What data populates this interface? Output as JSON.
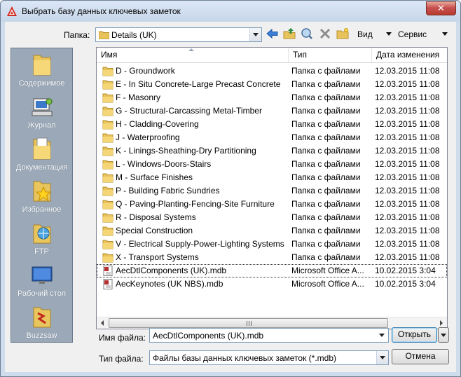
{
  "window": {
    "title": "Выбрать базу данных ключевых заметок",
    "close_label": "✕"
  },
  "toolbar": {
    "folder_label": "Папка:",
    "folder_value": "Details (UK)",
    "view_label": "Вид",
    "service_label": "Сервис"
  },
  "places": [
    {
      "label": "Содержимое",
      "icon": "folder-icon"
    },
    {
      "label": "Журнал",
      "icon": "history-icon"
    },
    {
      "label": "Документация",
      "icon": "documents-icon"
    },
    {
      "label": "Избранное",
      "icon": "favorites-icon"
    },
    {
      "label": "FTP",
      "icon": "ftp-icon"
    },
    {
      "label": "Рабочий стол",
      "icon": "desktop-icon"
    },
    {
      "label": "Buzzsaw",
      "icon": "buzzsaw-icon"
    }
  ],
  "filelist": {
    "columns": [
      "Имя",
      "Тип",
      "Дата изменения"
    ],
    "rows": [
      {
        "name": "D - Groundwork",
        "type": "Папка с файлами",
        "date": "12.03.2015 11:08",
        "kind": "folder"
      },
      {
        "name": "E - In Situ Concrete-Large Precast Concrete",
        "type": "Папка с файлами",
        "date": "12.03.2015 11:08",
        "kind": "folder"
      },
      {
        "name": "F - Masonry",
        "type": "Папка с файлами",
        "date": "12.03.2015 11:08",
        "kind": "folder"
      },
      {
        "name": "G - Structural-Carcassing Metal-Timber",
        "type": "Папка с файлами",
        "date": "12.03.2015 11:08",
        "kind": "folder"
      },
      {
        "name": "H - Cladding-Covering",
        "type": "Папка с файлами",
        "date": "12.03.2015 11:08",
        "kind": "folder"
      },
      {
        "name": "J - Waterproofing",
        "type": "Папка с файлами",
        "date": "12.03.2015 11:08",
        "kind": "folder"
      },
      {
        "name": "K - Linings-Sheathing-Dry Partitioning",
        "type": "Папка с файлами",
        "date": "12.03.2015 11:08",
        "kind": "folder"
      },
      {
        "name": "L - Windows-Doors-Stairs",
        "type": "Папка с файлами",
        "date": "12.03.2015 11:08",
        "kind": "folder"
      },
      {
        "name": "M - Surface Finishes",
        "type": "Папка с файлами",
        "date": "12.03.2015 11:08",
        "kind": "folder"
      },
      {
        "name": "P - Building Fabric Sundries",
        "type": "Папка с файлами",
        "date": "12.03.2015 11:08",
        "kind": "folder"
      },
      {
        "name": "Q - Paving-Planting-Fencing-Site Furniture",
        "type": "Папка с файлами",
        "date": "12.03.2015 11:08",
        "kind": "folder"
      },
      {
        "name": "R - Disposal Systems",
        "type": "Папка с файлами",
        "date": "12.03.2015 11:08",
        "kind": "folder"
      },
      {
        "name": "Special Construction",
        "type": "Папка с файлами",
        "date": "12.03.2015 11:08",
        "kind": "folder"
      },
      {
        "name": "V - Electrical Supply-Power-Lighting Systems",
        "type": "Папка с файлами",
        "date": "12.03.2015 11:08",
        "kind": "folder"
      },
      {
        "name": "X - Transport Systems",
        "type": "Папка с файлами",
        "date": "12.03.2015 11:08",
        "kind": "folder"
      },
      {
        "name": "AecDtlComponents (UK).mdb",
        "type": "Microsoft Office A...",
        "date": "10.02.2015 3:04",
        "kind": "file"
      },
      {
        "name": "AecKeynotes (UK NBS).mdb",
        "type": "Microsoft Office A...",
        "date": "10.02.2015 3:04",
        "kind": "file"
      }
    ]
  },
  "filename": {
    "label": "Имя файла:",
    "value": "AecDtlComponents (UK).mdb"
  },
  "filetype": {
    "label": "Тип файла:",
    "value": "Файлы базы данных ключевых заметок (*.mdb)"
  },
  "buttons": {
    "open_label": "Открыть",
    "cancel_label": "Отмена"
  },
  "colors": {
    "folder": "#e8c25a",
    "places_bg": "#9aa8b8",
    "title_bg": "#cfdcec",
    "close": "#c75050"
  }
}
